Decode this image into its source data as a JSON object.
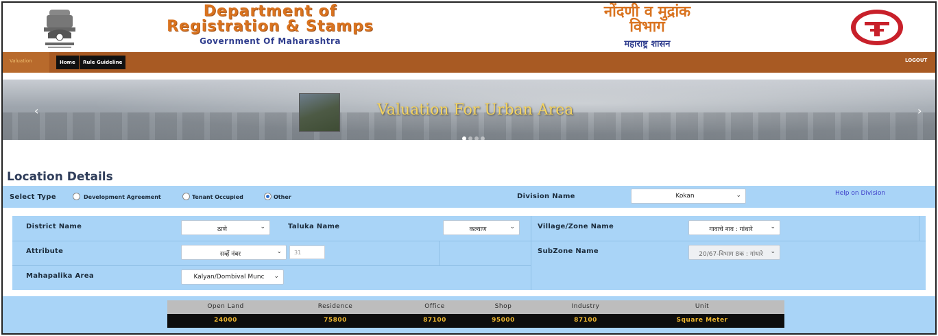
{
  "header": {
    "title_en_line1": "Department of",
    "title_en_line2": "Registration & Stamps",
    "title_en_line3": "Government Of Maharashtra",
    "title_mr_line1": "नोंदणी व मुद्रांक",
    "title_mr_line2": "विभाग",
    "title_mr_line3": "महाराष्ट्र शासन"
  },
  "nav": {
    "active": "Valuation",
    "home": "Home",
    "rule_guideline": "Rule Guideline",
    "logout": "LOGOUT"
  },
  "banner": {
    "caption": "Valuation For Urban Area",
    "slides": 4,
    "active_slide": 1
  },
  "location": {
    "title": "Location Details",
    "select_type_label": "Select Type",
    "types": [
      {
        "label": "Development Agreement",
        "checked": false
      },
      {
        "label": "Tenant Occupied",
        "checked": false
      },
      {
        "label": "Other",
        "checked": true
      }
    ],
    "division_label": "Division Name",
    "division_value": "Kokan",
    "help_link": "Help on Division",
    "district_label": "District Name",
    "district_value": "ठाणे",
    "taluka_label": "Taluka Name",
    "taluka_value": "कल्याण",
    "village_label": "Village/Zone Name",
    "village_value": "गावाचे नाव : गांधारे",
    "attribute_label": "Attribute",
    "attribute_value": "सर्व्हे नंबर",
    "attribute_input": "31",
    "subzone_label": "SubZone Name",
    "subzone_value": "20/67-विभाग 8क : गांधारे",
    "mahapalika_label": "Mahapalika Area",
    "mahapalika_value": "Kalyan/Dombival Munc"
  },
  "rates": {
    "headers": [
      "Open Land",
      "Residence",
      "Office",
      "Shop",
      "Industry",
      "Unit"
    ],
    "values": [
      "24000",
      "75800",
      "87100",
      "95000",
      "87100",
      "Square Meter"
    ]
  },
  "colors": {
    "nav_bg": "#a85a23",
    "form_bg": "#a9d4f7",
    "title_orange": "#d9731f",
    "title_blue": "#2f3d8e",
    "rate_text": "#f0b830"
  }
}
